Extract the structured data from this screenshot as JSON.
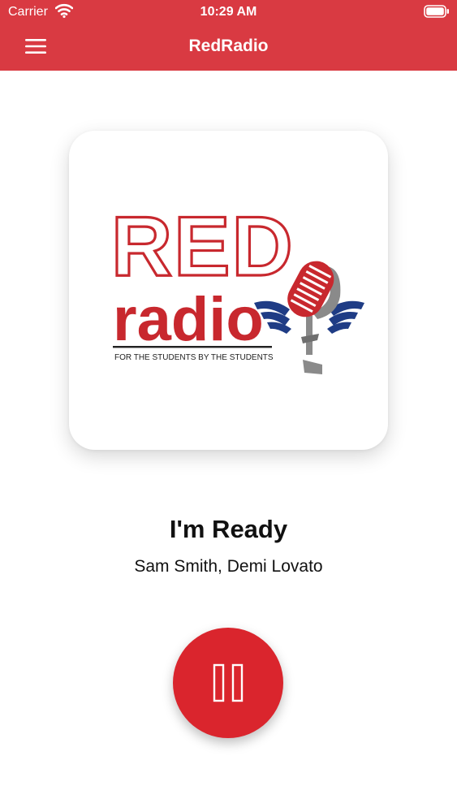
{
  "status_bar": {
    "carrier": "Carrier",
    "time": "10:29 AM"
  },
  "nav": {
    "title": "RedRadio",
    "menu_icon": "hamburger-menu-icon"
  },
  "artwork": {
    "logo_text_top": "RED",
    "logo_text_bottom": "radio",
    "tagline": "FOR THE STUDENTS BY THE STUDENTS"
  },
  "track": {
    "title": "I'm Ready",
    "artist": "Sam Smith, Demi Lovato"
  },
  "player": {
    "control_icon": "pause-icon"
  },
  "colors": {
    "brand_red": "#d93a42",
    "button_red": "#da252d",
    "logo_red": "#c8282e",
    "logo_blue": "#1f3c85",
    "mic_gray": "#8a8a8a"
  }
}
